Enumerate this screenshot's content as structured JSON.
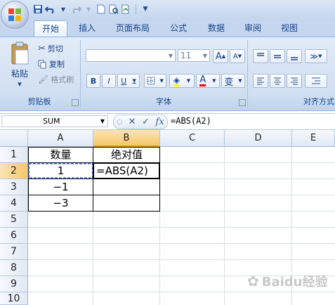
{
  "quick_access": {
    "save_icon": "save-icon",
    "undo_icon": "undo-icon",
    "redo_icon": "redo-icon",
    "new_icon": "new-icon",
    "print_preview_icon": "print-preview-icon",
    "open_icon": "open-icon",
    "customize_icon": "chevron-down-icon"
  },
  "tabs": [
    {
      "label": "开始",
      "active": true
    },
    {
      "label": "插入"
    },
    {
      "label": "页面布局"
    },
    {
      "label": "公式"
    },
    {
      "label": "数据"
    },
    {
      "label": "审阅"
    },
    {
      "label": "视图"
    }
  ],
  "ribbon": {
    "clipboard": {
      "paste_label": "粘贴",
      "cut_label": "剪切",
      "copy_label": "复制",
      "format_painter_label": "格式刷",
      "group_label": "剪贴板"
    },
    "font": {
      "font_name": "",
      "font_size": "11",
      "bold": "B",
      "italic": "I",
      "underline": "U",
      "grow": "A",
      "shrink": "A",
      "font_color_letter": "A",
      "phonetic": "变",
      "group_label": "字体"
    },
    "alignment": {
      "group_label": "对齐方式"
    }
  },
  "formula_bar": {
    "name_box": "SUM",
    "cancel": "✕",
    "enter": "✓",
    "fx": "fx",
    "formula": "=ABS(A2)"
  },
  "sheet": {
    "columns": [
      "A",
      "B",
      "C",
      "D",
      "E"
    ],
    "rows": [
      "1",
      "2",
      "3",
      "4",
      "5",
      "6",
      "7",
      "8",
      "9",
      "10"
    ],
    "cells": {
      "A1": "数量",
      "B1": "绝对值",
      "A2": "1",
      "B2": "=ABS(A2)",
      "A3": "−1",
      "A4": "−3"
    }
  },
  "watermark": "Baidu经验"
}
